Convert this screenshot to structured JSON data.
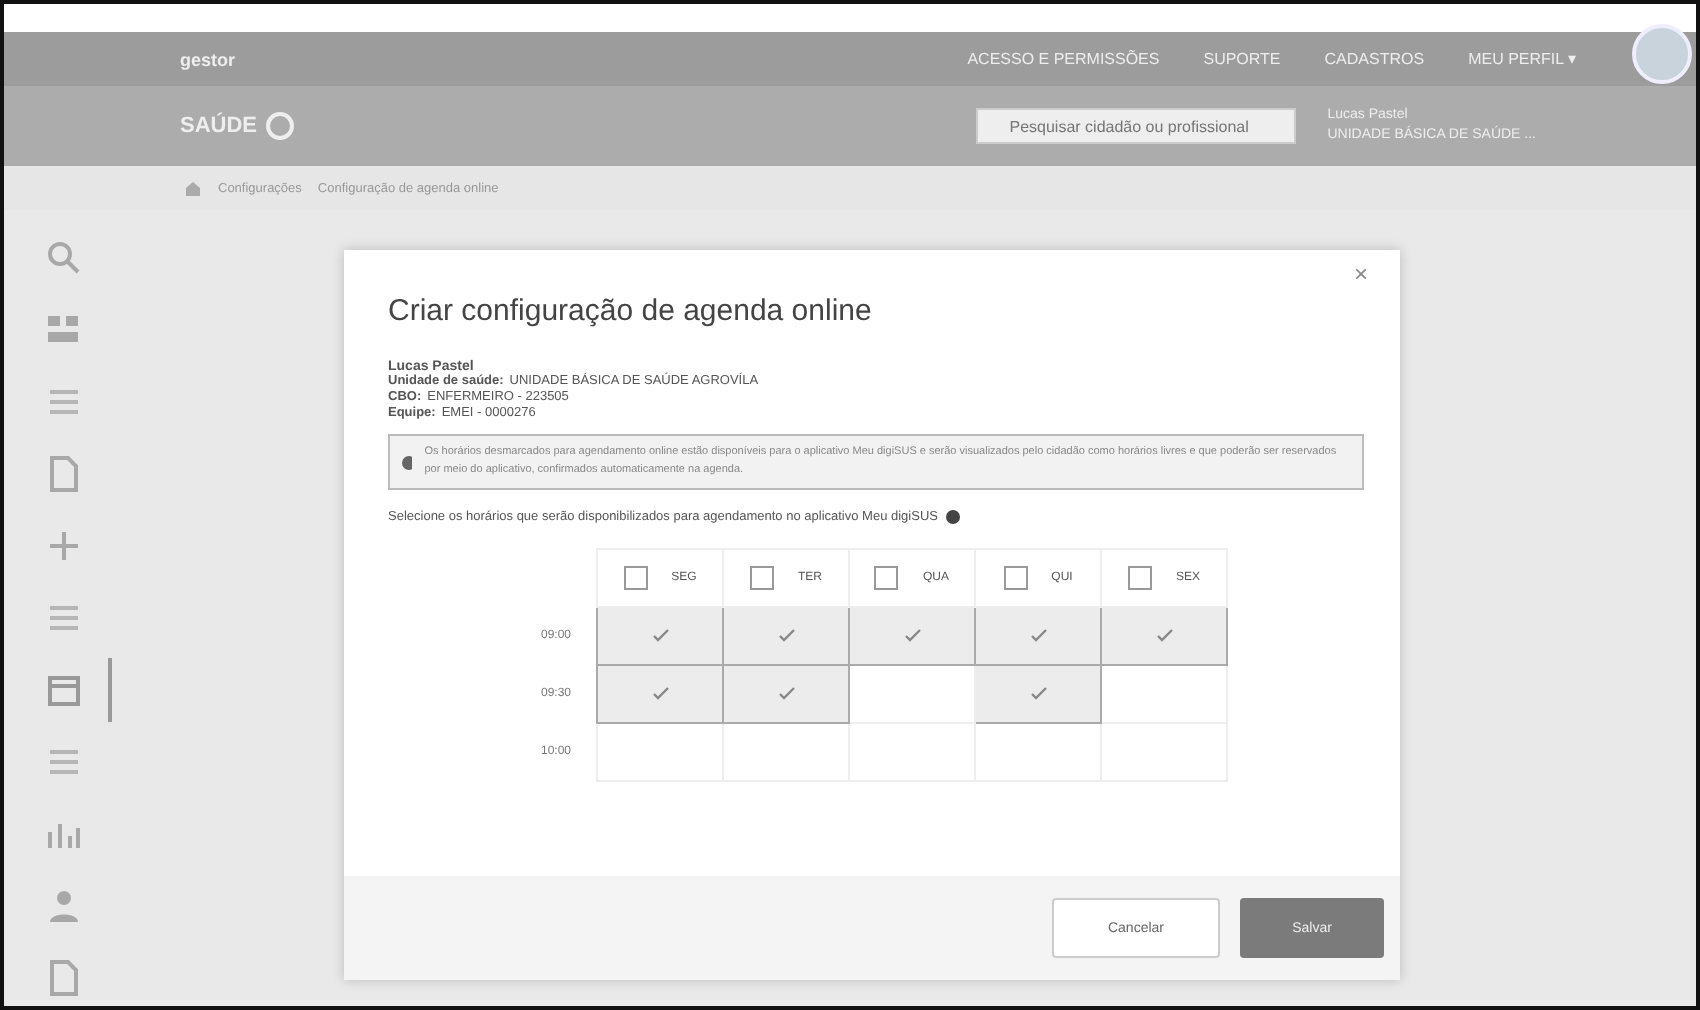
{
  "topbar": {
    "brand": "gestor",
    "nav": [
      "ACESSO E PERMISSÕES",
      "SUPORTE",
      "CADASTROS",
      "MEU PERFIL ▾"
    ],
    "logo": "SAÚDE",
    "search": {
      "placeholder": "Pesquisar cidadão ou profissional"
    },
    "user": {
      "line_1": "Lucas Pastel",
      "line_2": "UNIDADE BÁSICA DE SAÚDE ..."
    }
  },
  "breadcrumb": [
    "Configurações",
    "Configuração de agenda online"
  ],
  "sidebar": {
    "items": [
      {
        "kind": "search",
        "selected": false
      },
      {
        "kind": "grid",
        "selected": false
      },
      {
        "kind": "list",
        "selected": false
      },
      {
        "kind": "doc",
        "selected": false
      },
      {
        "kind": "plus",
        "selected": false
      },
      {
        "kind": "list",
        "selected": false
      },
      {
        "kind": "calendar",
        "selected": true
      },
      {
        "kind": "list",
        "selected": false
      },
      {
        "kind": "chart",
        "selected": false
      },
      {
        "kind": "person",
        "selected": false
      },
      {
        "kind": "doc",
        "selected": false
      }
    ]
  },
  "modal": {
    "title": "Criar configuração de agenda online",
    "close": "×",
    "professional": "Lucas Pastel",
    "details": [
      {
        "label": "Unidade de saúde:",
        "value": "UNIDADE BÁSICA DE SAÚDE AGROVÍLA"
      },
      {
        "label": "CBO:",
        "value": "ENFERMEIRO - 223505"
      },
      {
        "label": "Equipe:",
        "value": "EMEI - 0000276"
      }
    ],
    "notice": "Os horários desmarcados para agendamento online estão disponíveis para o aplicativo Meu digiSUS e serão visualizados pelo cidadão como horários livres e que poderão ser reservados por meio do aplicativo, confirmados automaticamente na agenda.",
    "instruction": "Selecione os horários que serão disponibilizados para agendamento no aplicativo Meu digiSUS",
    "days": [
      {
        "label": "SEG",
        "checked": false
      },
      {
        "label": "TER",
        "checked": false
      },
      {
        "label": "QUA",
        "checked": false
      },
      {
        "label": "QUI",
        "checked": false
      },
      {
        "label": "SEX",
        "checked": false
      }
    ],
    "rows": [
      {
        "time": "09:00",
        "slots": [
          {
            "selected": true
          },
          {
            "selected": true
          },
          {
            "selected": true
          },
          {
            "selected": true
          },
          {
            "selected": true
          }
        ]
      },
      {
        "time": "09:30",
        "slots": [
          {
            "selected": true
          },
          {
            "selected": true
          },
          {
            "selected": false
          },
          {
            "selected": true
          },
          {
            "selected": false
          }
        ]
      },
      {
        "time": "10:00",
        "slots": [
          {
            "selected": false
          },
          {
            "selected": false
          },
          {
            "selected": false
          },
          {
            "selected": false
          },
          {
            "selected": false
          }
        ]
      }
    ],
    "buttons": [
      {
        "label": "Cancelar",
        "kind": "secondary"
      },
      {
        "label": "Salvar",
        "kind": "primary"
      }
    ]
  }
}
